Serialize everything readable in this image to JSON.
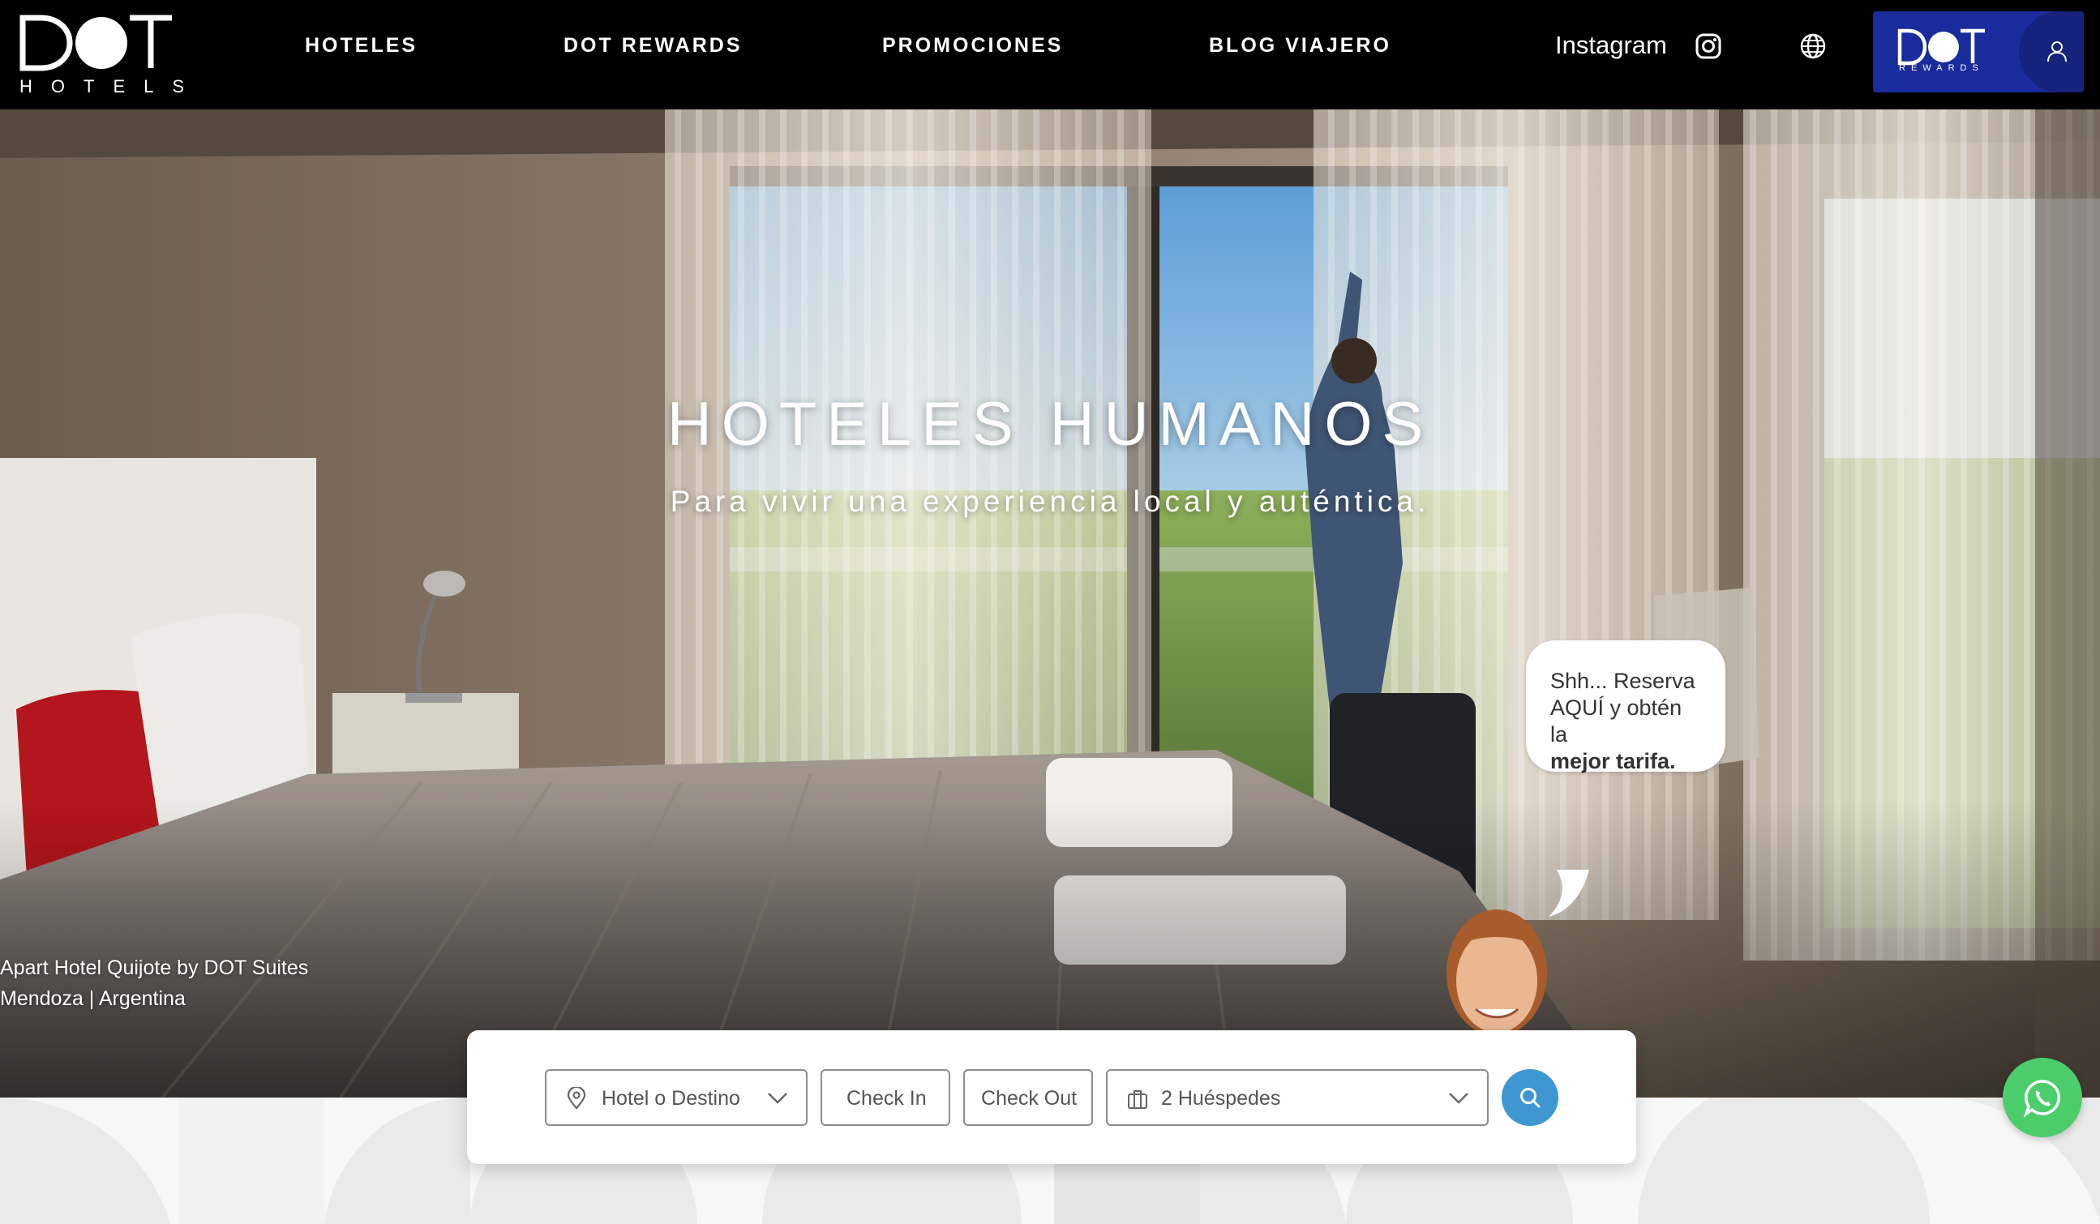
{
  "header": {
    "logo": {
      "word": "DOT",
      "sub": "HOTELS"
    },
    "nav": [
      {
        "label": "HOTELES"
      },
      {
        "label": "DOT REWARDS"
      },
      {
        "label": "PROMOCIONES"
      },
      {
        "label": "BLOG VIAJERO"
      }
    ],
    "instagram_label": "Instagram",
    "rewards": {
      "word": "DOT",
      "sub": "REWARDS"
    },
    "icons": [
      "instagram-icon",
      "globe-icon",
      "user-icon"
    ]
  },
  "hero": {
    "title": "HOTELES HUMANOS",
    "subtitle": "Para vivir una experiencia local y auténtica.",
    "caption_line1": "Apart Hotel Quijote by DOT Suites",
    "caption_line2": "Mendoza | Argentina"
  },
  "bubble": {
    "line1": "Shh... Reserva",
    "line2": "AQUÍ y obtén la",
    "line3": "mejor tarifa."
  },
  "search": {
    "destination": "Hotel o Destino",
    "check_in": "Check In",
    "check_out": "Check Out",
    "guests": "2 Huéspedes",
    "icons": [
      "location-pin-icon",
      "chevron-down-icon",
      "luggage-icon",
      "search-icon"
    ]
  },
  "colors": {
    "header_bg": "#000000",
    "rewards_bg": "#1a2b9b",
    "search_button": "#3f97d1",
    "whatsapp": "#4ccd6c"
  }
}
